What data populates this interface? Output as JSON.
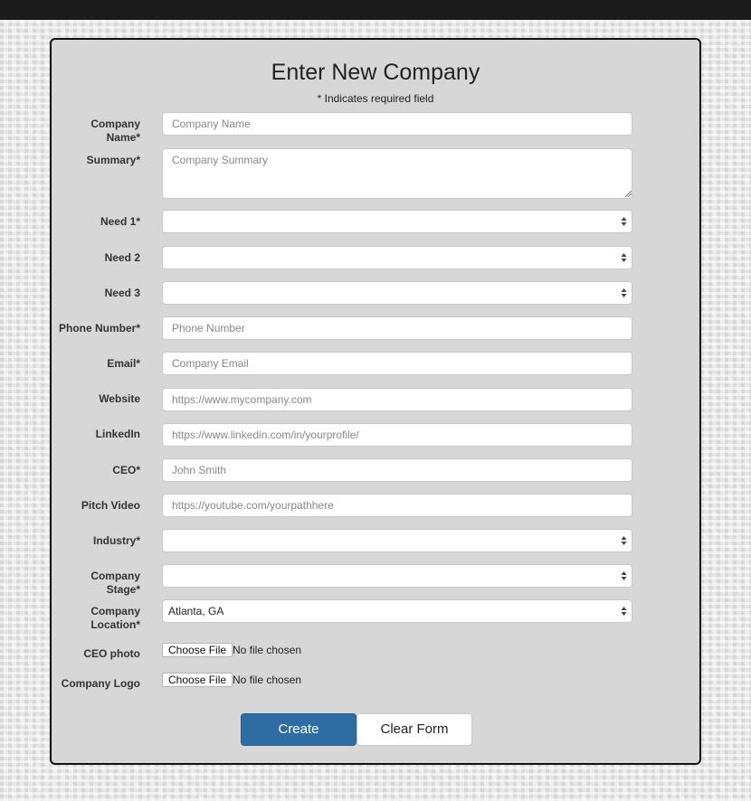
{
  "form": {
    "title": "Enter New Company",
    "required_note": "* Indicates required field",
    "fields": {
      "company_name": {
        "label": "Company Name*",
        "placeholder": "Company Name"
      },
      "summary": {
        "label": "Summary*",
        "placeholder": "Company Summary"
      },
      "need1": {
        "label": "Need 1*",
        "value": ""
      },
      "need2": {
        "label": "Need 2",
        "value": ""
      },
      "need3": {
        "label": "Need 3",
        "value": ""
      },
      "phone": {
        "label": "Phone Number*",
        "placeholder": "Phone Number"
      },
      "email": {
        "label": "Email*",
        "placeholder": "Company Email"
      },
      "website": {
        "label": "Website",
        "placeholder": "https://www.mycompany.com"
      },
      "linkedin": {
        "label": "LinkedIn",
        "placeholder": "https://www.linkedin.com/in/yourprofile/"
      },
      "ceo": {
        "label": "CEO*",
        "placeholder": "John Smith"
      },
      "pitch_video": {
        "label": "Pitch Video",
        "placeholder": "https://youtube.com/yourpathhere"
      },
      "industry": {
        "label": "Industry*",
        "value": ""
      },
      "company_stage": {
        "label": "Company Stage*",
        "value": ""
      },
      "company_location": {
        "label_line1": "Company",
        "label_line2": "Location*",
        "value": "Atlanta, GA"
      },
      "ceo_photo": {
        "label": "CEO photo",
        "button": "Choose File",
        "status": "No file chosen"
      },
      "company_logo": {
        "label": "Company Logo",
        "button": "Choose File",
        "status": "No file chosen"
      }
    },
    "buttons": {
      "create": "Create",
      "clear": "Clear Form"
    }
  },
  "colors": {
    "primary_button": "#2e6da4",
    "card_background": "#d7d7d7",
    "topbar": "#1b1b1b"
  },
  "icons": {
    "select_arrow": "up-down-chevron-icon",
    "textarea_resize": "resize-grip-icon"
  }
}
